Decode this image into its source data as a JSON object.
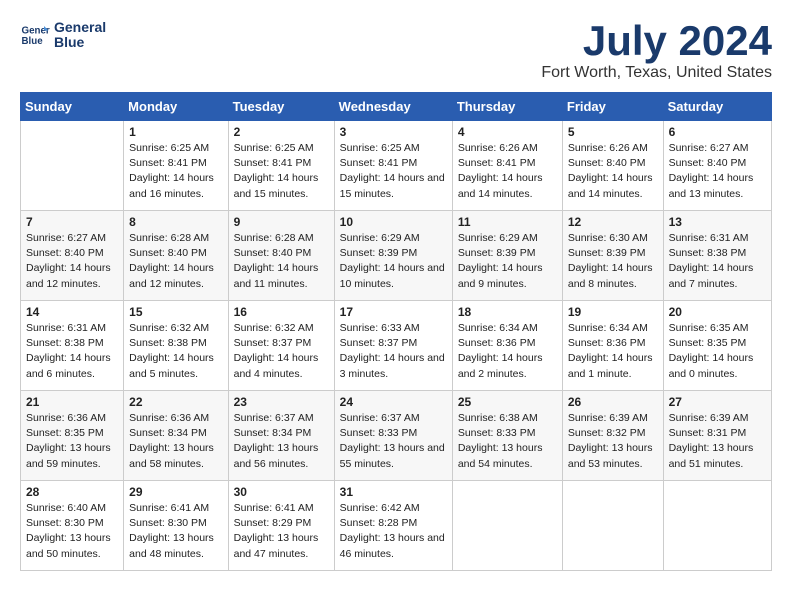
{
  "header": {
    "logo_line1": "General",
    "logo_line2": "Blue",
    "title": "July 2024",
    "subtitle": "Fort Worth, Texas, United States"
  },
  "days_of_week": [
    "Sunday",
    "Monday",
    "Tuesday",
    "Wednesday",
    "Thursday",
    "Friday",
    "Saturday"
  ],
  "weeks": [
    [
      {
        "day": "",
        "data": ""
      },
      {
        "day": "1",
        "data": "Sunrise: 6:25 AM\nSunset: 8:41 PM\nDaylight: 14 hours and 16 minutes."
      },
      {
        "day": "2",
        "data": "Sunrise: 6:25 AM\nSunset: 8:41 PM\nDaylight: 14 hours and 15 minutes."
      },
      {
        "day": "3",
        "data": "Sunrise: 6:25 AM\nSunset: 8:41 PM\nDaylight: 14 hours and 15 minutes."
      },
      {
        "day": "4",
        "data": "Sunrise: 6:26 AM\nSunset: 8:41 PM\nDaylight: 14 hours and 14 minutes."
      },
      {
        "day": "5",
        "data": "Sunrise: 6:26 AM\nSunset: 8:40 PM\nDaylight: 14 hours and 14 minutes."
      },
      {
        "day": "6",
        "data": "Sunrise: 6:27 AM\nSunset: 8:40 PM\nDaylight: 14 hours and 13 minutes."
      }
    ],
    [
      {
        "day": "7",
        "data": "Sunrise: 6:27 AM\nSunset: 8:40 PM\nDaylight: 14 hours and 12 minutes."
      },
      {
        "day": "8",
        "data": "Sunrise: 6:28 AM\nSunset: 8:40 PM\nDaylight: 14 hours and 12 minutes."
      },
      {
        "day": "9",
        "data": "Sunrise: 6:28 AM\nSunset: 8:40 PM\nDaylight: 14 hours and 11 minutes."
      },
      {
        "day": "10",
        "data": "Sunrise: 6:29 AM\nSunset: 8:39 PM\nDaylight: 14 hours and 10 minutes."
      },
      {
        "day": "11",
        "data": "Sunrise: 6:29 AM\nSunset: 8:39 PM\nDaylight: 14 hours and 9 minutes."
      },
      {
        "day": "12",
        "data": "Sunrise: 6:30 AM\nSunset: 8:39 PM\nDaylight: 14 hours and 8 minutes."
      },
      {
        "day": "13",
        "data": "Sunrise: 6:31 AM\nSunset: 8:38 PM\nDaylight: 14 hours and 7 minutes."
      }
    ],
    [
      {
        "day": "14",
        "data": "Sunrise: 6:31 AM\nSunset: 8:38 PM\nDaylight: 14 hours and 6 minutes."
      },
      {
        "day": "15",
        "data": "Sunrise: 6:32 AM\nSunset: 8:38 PM\nDaylight: 14 hours and 5 minutes."
      },
      {
        "day": "16",
        "data": "Sunrise: 6:32 AM\nSunset: 8:37 PM\nDaylight: 14 hours and 4 minutes."
      },
      {
        "day": "17",
        "data": "Sunrise: 6:33 AM\nSunset: 8:37 PM\nDaylight: 14 hours and 3 minutes."
      },
      {
        "day": "18",
        "data": "Sunrise: 6:34 AM\nSunset: 8:36 PM\nDaylight: 14 hours and 2 minutes."
      },
      {
        "day": "19",
        "data": "Sunrise: 6:34 AM\nSunset: 8:36 PM\nDaylight: 14 hours and 1 minute."
      },
      {
        "day": "20",
        "data": "Sunrise: 6:35 AM\nSunset: 8:35 PM\nDaylight: 14 hours and 0 minutes."
      }
    ],
    [
      {
        "day": "21",
        "data": "Sunrise: 6:36 AM\nSunset: 8:35 PM\nDaylight: 13 hours and 59 minutes."
      },
      {
        "day": "22",
        "data": "Sunrise: 6:36 AM\nSunset: 8:34 PM\nDaylight: 13 hours and 58 minutes."
      },
      {
        "day": "23",
        "data": "Sunrise: 6:37 AM\nSunset: 8:34 PM\nDaylight: 13 hours and 56 minutes."
      },
      {
        "day": "24",
        "data": "Sunrise: 6:37 AM\nSunset: 8:33 PM\nDaylight: 13 hours and 55 minutes."
      },
      {
        "day": "25",
        "data": "Sunrise: 6:38 AM\nSunset: 8:33 PM\nDaylight: 13 hours and 54 minutes."
      },
      {
        "day": "26",
        "data": "Sunrise: 6:39 AM\nSunset: 8:32 PM\nDaylight: 13 hours and 53 minutes."
      },
      {
        "day": "27",
        "data": "Sunrise: 6:39 AM\nSunset: 8:31 PM\nDaylight: 13 hours and 51 minutes."
      }
    ],
    [
      {
        "day": "28",
        "data": "Sunrise: 6:40 AM\nSunset: 8:30 PM\nDaylight: 13 hours and 50 minutes."
      },
      {
        "day": "29",
        "data": "Sunrise: 6:41 AM\nSunset: 8:30 PM\nDaylight: 13 hours and 48 minutes."
      },
      {
        "day": "30",
        "data": "Sunrise: 6:41 AM\nSunset: 8:29 PM\nDaylight: 13 hours and 47 minutes."
      },
      {
        "day": "31",
        "data": "Sunrise: 6:42 AM\nSunset: 8:28 PM\nDaylight: 13 hours and 46 minutes."
      },
      {
        "day": "",
        "data": ""
      },
      {
        "day": "",
        "data": ""
      },
      {
        "day": "",
        "data": ""
      }
    ]
  ]
}
